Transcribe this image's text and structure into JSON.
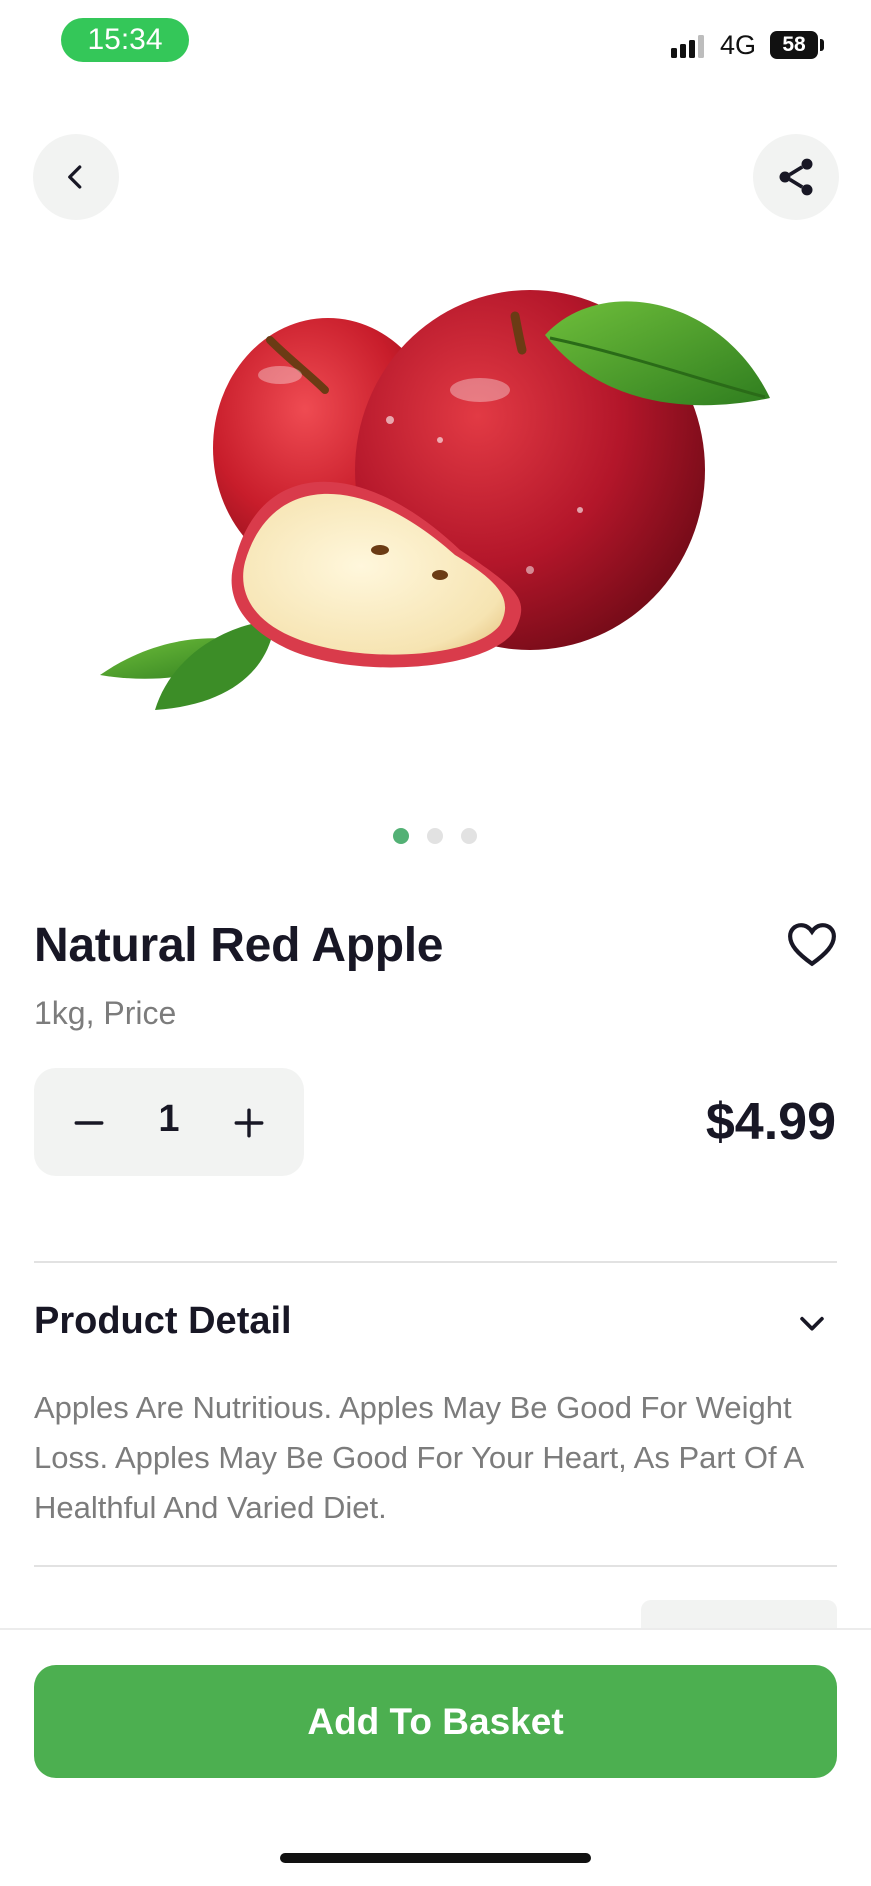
{
  "status_bar": {
    "time": "15:34",
    "network": "4G",
    "battery": "58"
  },
  "product": {
    "name": "Natural Red Apple",
    "unit": "1kg, Price",
    "quantity": "1",
    "price": "$4.99",
    "image_icon": "apple-image",
    "carousel": {
      "total": 3,
      "active_index": 0
    }
  },
  "sections": {
    "detail_title": "Product Detail",
    "detail_text": "Apples Are Nutritious. Apples May Be Good For Weight Loss. Apples May Be Good For Your Heart, As Part Of A Healthful And Varied Diet."
  },
  "actions": {
    "add_to_basket": "Add To Basket"
  },
  "icons": {
    "back": "chevron-left-icon",
    "share": "share-icon",
    "favorite": "heart-outline-icon",
    "decrement": "minus-icon",
    "increment": "plus-icon",
    "expand": "chevron-down-icon"
  },
  "colors": {
    "accent": "#53b175",
    "cta": "#4caf50",
    "time_pill": "#34c759"
  }
}
